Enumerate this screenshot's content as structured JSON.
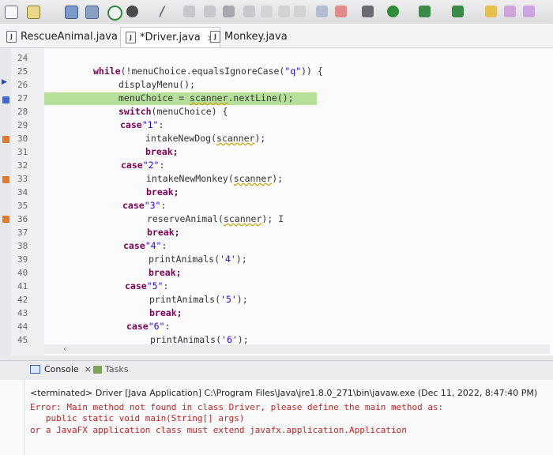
{
  "tabs": [
    {
      "label": "RescueAnimal.java",
      "active": false
    },
    {
      "label": "*Driver.java",
      "active": true,
      "close": "⨯"
    },
    {
      "label": "Monkey.java",
      "active": false
    }
  ],
  "line_numbers": [
    "24",
    "25",
    "26",
    "27",
    "28",
    "29",
    "30",
    "31",
    "32",
    "33",
    "34",
    "35",
    "36",
    "37",
    "38",
    "39",
    "40",
    "41",
    "42",
    "43",
    "44",
    "45"
  ],
  "code": {
    "l25_kw": "while",
    "l25_a": "(!menuChoice.equalsIgnoreCase(",
    "l25_str": "\"q\"",
    "l25_b": ")) {",
    "l26": "displayMenu();",
    "l27_a": "menuChoice = ",
    "l27_w": "scanner",
    "l27_b": ".nextLine();",
    "l28_kw": "switch",
    "l28_a": "(menuChoice) {",
    "l29_kw": "case",
    "l29_str": "\"1\"",
    "l29_b": ":",
    "l30_a": "intakeNewDog(",
    "l30_w": "scanner",
    "l30_b": ");",
    "l31": "break;",
    "l32_kw": "case",
    "l32_str": "\"2\"",
    "l32_b": ":",
    "l33_a": "intakeNewMonkey(",
    "l33_w": "scanner",
    "l33_b": ");",
    "l34": "break;",
    "l35_kw": "case",
    "l35_str": "\"3\"",
    "l35_b": ":",
    "l36_a": "reserveAnimal(",
    "l36_w": "scanner",
    "l36_b": ");",
    "l37": "break;",
    "l38_kw": "case",
    "l38_str": "\"4\"",
    "l38_b": ":",
    "l39_a": "printAnimals(",
    "l39_str": "'4'",
    "l39_b": ");",
    "l40": "break;",
    "l41_kw": "case",
    "l41_str": "\"5\"",
    "l41_b": ":",
    "l42_a": "printAnimals(",
    "l42_str": "'5'",
    "l42_b": ");",
    "l43": "break;",
    "l44_kw": "case",
    "l44_str": "\"6\"",
    "l44_b": ":",
    "l45_a": "printAnimals(",
    "l45_str": "'6'",
    "l45_b": ");"
  },
  "console": {
    "tab_label": "Console",
    "tab_close": "⨯",
    "tasks_label": "Tasks",
    "terminated": "<terminated> Driver [Java Application] C:\\Program Files\\Java\\jre1.8.0_271\\bin\\javaw.exe (Dec 11, 2022, 8:47:40 PM)",
    "error_line1": "Error: Main method not found in class Driver, please define the main method as:",
    "error_line2": "   public static void main(String[] args)",
    "error_line3": "or a JavaFX application class must extend javafx.application.Application"
  },
  "colors": {
    "keyword": "#7f0055",
    "string": "#2a00ff",
    "highlight_line": "#b6e09a",
    "error_text": "#cc2020"
  }
}
